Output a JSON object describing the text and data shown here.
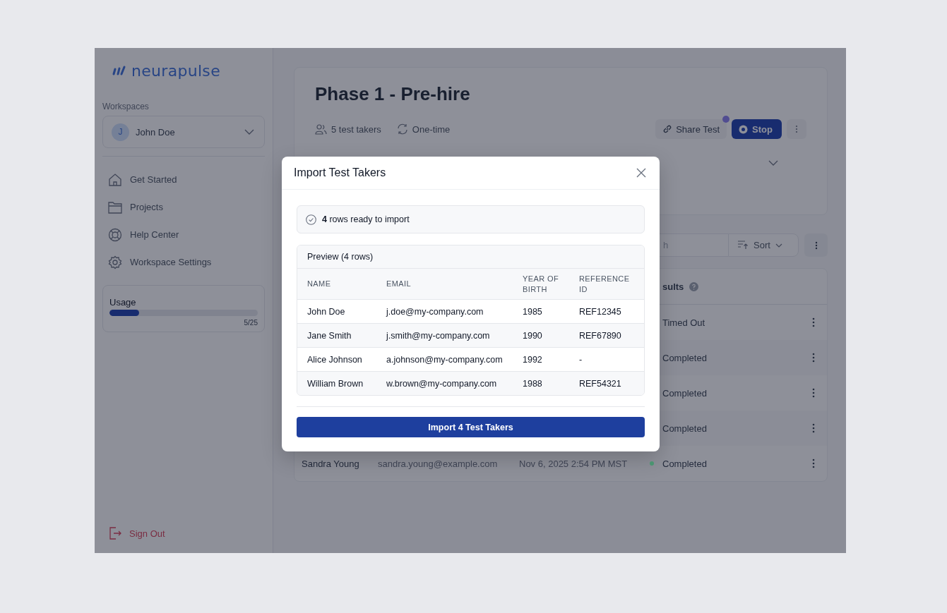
{
  "sidebar": {
    "logo": "neurapulse",
    "workspaces_label": "Workspaces",
    "workspace": {
      "initial": "J",
      "name": "John Doe"
    },
    "nav": [
      {
        "kind": "home",
        "label": "Get Started"
      },
      {
        "kind": "folder",
        "label": "Projects"
      },
      {
        "kind": "help",
        "label": "Help Center"
      },
      {
        "kind": "settings",
        "label": "Workspace Settings"
      }
    ],
    "usage": {
      "label": "Usage",
      "level": 0.2,
      "reading": "5/25"
    },
    "sign_out": "Sign Out"
  },
  "header": {
    "title": "Phase 1 - Pre-hire",
    "test_takers": "5 test takers",
    "frequency": "One-time",
    "share_button": "Share Test",
    "share_notification": true,
    "stop_button": "Stop"
  },
  "toolbar": {
    "search_placeholder": "h",
    "sort_button": "Sort"
  },
  "table": {
    "results_heading": "sults",
    "rows": [
      {
        "result": "Timed Out"
      },
      {
        "result": "Completed"
      },
      {
        "result": "Completed"
      },
      {
        "result": "Completed"
      },
      {
        "name": "Sandra Young",
        "email": "sandra.young@example.com",
        "date": "Nov 6, 2025 2:54 PM MST",
        "result": "Completed",
        "color": "#4a9470"
      }
    ]
  },
  "modal": {
    "title": "Import Test Takers",
    "summary": "**4** rows ready to import",
    "preview_title": "Preview (4 rows)",
    "columns": [
      "NAME",
      "EMAIL",
      "YEAR OF BIRTH",
      "REFERENCE ID"
    ],
    "rows": [
      [
        "John Doe",
        "j.doe@my-company.com",
        "1985",
        "REF12345"
      ],
      [
        "Jane Smith",
        "j.smith@my-company.com",
        "1990",
        "REF67890"
      ],
      [
        "Alice Johnson",
        "a.johnson@my-company.com",
        "1992",
        "-"
      ],
      [
        "William Brown",
        "w.brown@my-company.com",
        "1988",
        "REF54321"
      ]
    ],
    "import_button": "Import 4 Test Takers"
  }
}
